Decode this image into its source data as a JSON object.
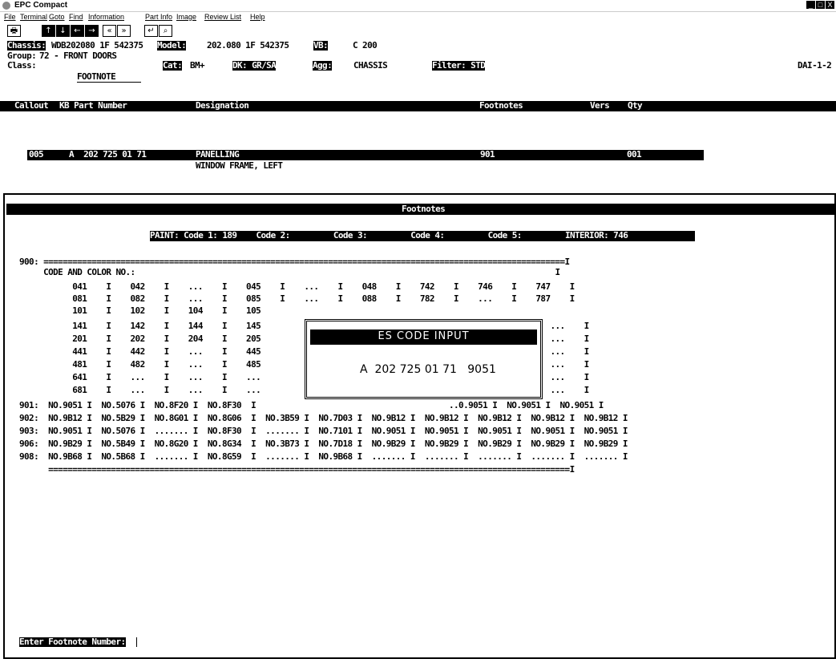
{
  "window": {
    "title": "EPC Compact",
    "buttons": [
      "_",
      "□",
      "X"
    ]
  },
  "menu": [
    "File",
    "Terminal",
    "Goto",
    "Find",
    "Information",
    "Part Info",
    "Image",
    "Review List",
    "Help"
  ],
  "toolbar": {
    "icons": [
      "print-icon",
      "arrow-up-icon",
      "arrow-down-icon",
      "arrow-left-icon",
      "arrow-right-icon",
      "page-back-icon",
      "page-forward-icon",
      "return-icon",
      "search-icon"
    ],
    "glyphs": [
      "🖶",
      "↑",
      "↓",
      "←",
      "→",
      "«",
      "»",
      "↵",
      "⌕"
    ]
  },
  "header": {
    "chassis_label": "Chassis:",
    "chassis_value": "WDB202080 1F 542375",
    "model_label": "Model:",
    "model_value": "202.080 1F 542375",
    "vb_label": "VB:",
    "vb_value": "C 200",
    "group_label": "Group:",
    "group_value": "72 - FRONT DOORS",
    "class_label": "Class:",
    "cat_label": "Cat:",
    "cat_value": "BM+",
    "dk_label": "DK: GR/SA",
    "agg_label": "Agg:",
    "agg_value": "CHASSIS",
    "filter_label": "Filter: STD",
    "code": "DAI-1-2",
    "footnote_tab": "FOOTNOTE"
  },
  "columns": [
    "Callout",
    "KB Part Number",
    "Designation",
    "Footnotes",
    "Vers",
    "Qty"
  ],
  "part_row": {
    "callout": "005",
    "part_number": "A  202 725 01 71",
    "designation": "PANELLING",
    "designation2": "WINDOW FRAME, LEFT",
    "footnotes": "901",
    "qty": "001"
  },
  "footnotes_panel": {
    "title": "Footnotes",
    "paint_bar": "PAINT: Code 1: 189    Code 2:         Code 3:         Code 4:         Code 5:         INTERIOR: 746",
    "lines": [
      "900: ============================================================================================================I",
      "     CODE AND COLOR NO.:                                                                                       I",
      "           041    I    042    I    ...    I    045    I    ...    I    048    I    742    I    746    I    747    I",
      "           081    I    082    I    ...    I    085    I    ...    I    088    I    782    I    ...    I    787    I",
      "           101    I    102    I    104    I    105",
      "           141    I    142    I    144    I    145                                                ...    I    ...    I",
      "           201    I    202    I    204    I    205                                                ...    I    ...    I",
      "           441    I    442    I    ...    I    445                                                ...    I    ...    I",
      "           481    I    482    I    ...    I    485                                                ...    I    ...    I",
      "           641    I    ...    I    ...    I    ...                                                ...    I    ...    I",
      "           681    I    ...    I    ...    I    ...                                                ...    I    ...    I",
      "901:  NO.9051 I  NO.5076 I  NO.8F20 I  NO.8F30  I                                        ..0.9051 I  NO.9051 I  NO.9051 I",
      "902:  NO.9B12 I  NO.5B29 I  NO.8G01 I  NO.8G06  I  NO.3B59 I  NO.7D03 I  NO.9B12 I  NO.9B12 I  NO.9B12 I  NO.9B12 I  NO.9B12 I",
      "903:  NO.9051 I  NO.5076 I  ....... I  NO.8F30  I  ....... I  NO.7101 I  NO.9051 I  NO.9051 I  NO.9051 I  NO.9051 I  NO.9051 I",
      "906:  NO.9B29 I  NO.5B49 I  NO.8G20 I  NO.8G34  I  NO.3B73 I  NO.7D18 I  NO.9B29 I  NO.9B29 I  NO.9B29 I  NO.9B29 I  NO.9B29 I",
      "908:  NO.9B68 I  NO.5B68 I  ....... I  NO.8G59  I  ....... I  NO.9B68 I  ....... I  ....... I  ....... I  ....... I  ....... I",
      "      ============================================================================================================I"
    ]
  },
  "popup": {
    "title": "ES CODE INPUT",
    "value": "A  202 725 01 71   9051"
  },
  "prompt": "Enter Footnote Number:"
}
